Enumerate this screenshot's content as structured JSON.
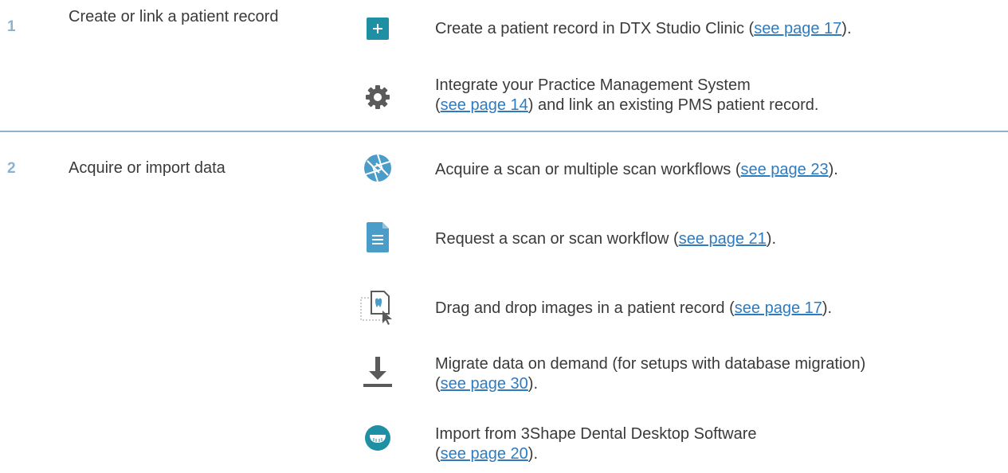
{
  "steps": [
    {
      "number": "1",
      "title": "Create or link a patient record",
      "items": [
        {
          "icon": "plus-icon",
          "lines": [
            {
              "before": "Create a patient record in DTX Studio Clinic (",
              "link": "see page 17",
              "after": ")."
            }
          ]
        },
        {
          "icon": "gear-icon",
          "lines": [
            {
              "before": "Integrate your Practice Management System",
              "link": "",
              "after": ""
            },
            {
              "before": "(",
              "link": "see page 14",
              "after": ") and link an existing PMS patient record."
            }
          ]
        }
      ]
    },
    {
      "number": "2",
      "title": "Acquire or import data",
      "items": [
        {
          "icon": "aperture-icon",
          "lines": [
            {
              "before": "Acquire a scan or multiple scan workflows (",
              "link": "see page 23",
              "after": ")."
            }
          ]
        },
        {
          "icon": "document-icon",
          "lines": [
            {
              "before": "Request a scan or scan workflow (",
              "link": "see page 21",
              "after": ")."
            }
          ]
        },
        {
          "icon": "drag-drop-icon",
          "lines": [
            {
              "before": "Drag and drop images in a patient record (",
              "link": "see page 17",
              "after": ")."
            }
          ]
        },
        {
          "icon": "download-icon",
          "lines": [
            {
              "before": "Migrate data on demand (for setups with database migration)",
              "link": "",
              "after": ""
            },
            {
              "before": "(",
              "link": "see page 30",
              "after": ")."
            }
          ]
        },
        {
          "icon": "dental-arch-icon",
          "lines": [
            {
              "before": "Import from 3Shape Dental Desktop Software",
              "link": "",
              "after": ""
            },
            {
              "before": "(",
              "link": "see page 20",
              "after": ")."
            }
          ]
        }
      ]
    }
  ],
  "colors": {
    "accent": "#8fb2cc",
    "link": "#2f7bbf",
    "icon_teal": "#1f8fa3",
    "icon_gray": "#5a5a5a",
    "icon_blue": "#4a9cc9"
  }
}
